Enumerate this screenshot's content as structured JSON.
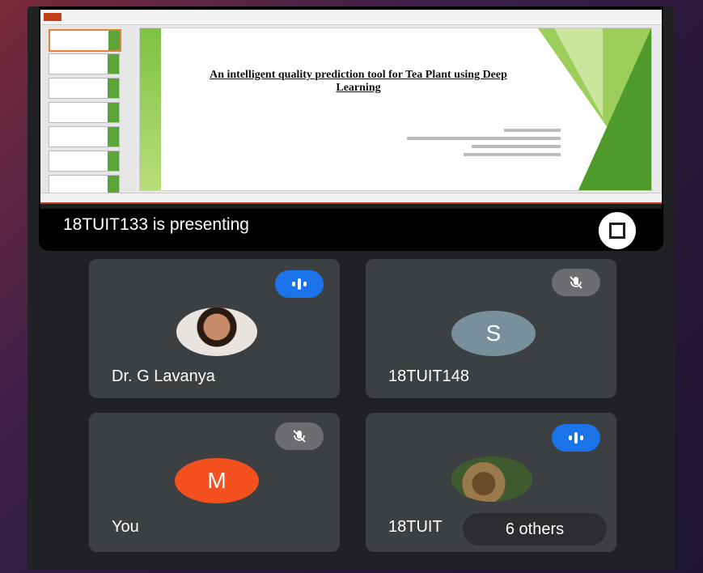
{
  "presentation": {
    "slide_title": "An intelligent quality prediction tool for Tea Plant using Deep Learning",
    "presenting_label": "18TUIT133 is presenting"
  },
  "participants": [
    {
      "name": "Dr. G Lavanya",
      "status": "speaking",
      "avatar": "photo"
    },
    {
      "name": "18TUIT148",
      "status": "muted",
      "avatar_initial": "S"
    },
    {
      "name": "You",
      "status": "muted",
      "avatar_initial": "M"
    },
    {
      "name": "18TUIT",
      "status": "speaking",
      "avatar": "photo",
      "others_label": "6 others"
    }
  ],
  "colors": {
    "background": "#202124",
    "tile": "#3c4043",
    "speaking_badge": "#1a73e8",
    "muted_badge": "#6b6d70",
    "avatar_s": "#78909c",
    "avatar_m": "#f4511e"
  }
}
